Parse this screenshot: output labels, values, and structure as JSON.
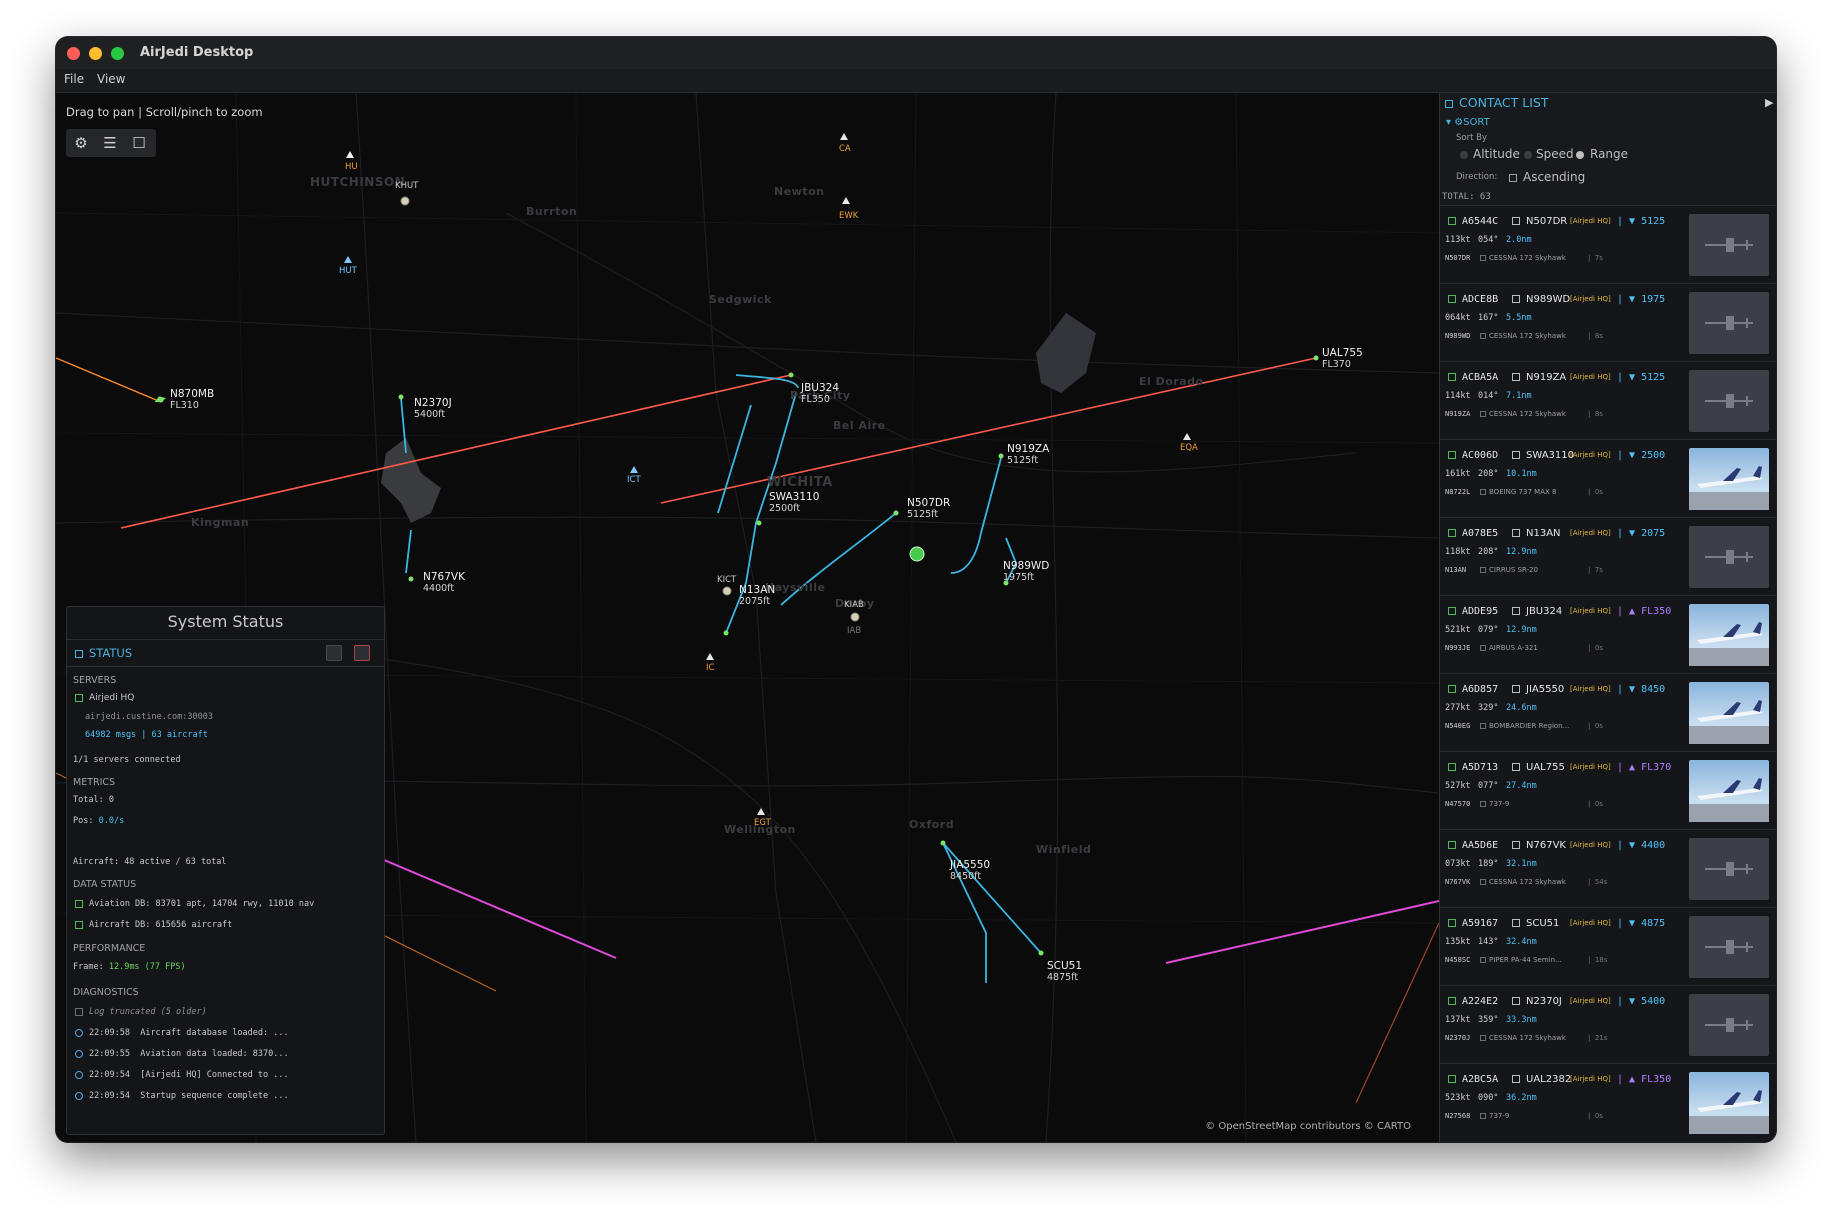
{
  "window": {
    "title": "AirJedi Desktop"
  },
  "menu": [
    "File",
    "View"
  ],
  "map": {
    "hint": "Drag to pan | Scroll/pinch to zoom",
    "attribution": "© OpenStreetMap contributors © CARTO",
    "cities": [
      "HUTCHINSON",
      "Burrton",
      "Newton",
      "Sedgwick",
      "Park City",
      "Bel Aire",
      "WICHITA",
      "El Dorado",
      "Kingman",
      "Haysville",
      "Derby",
      "Wellington",
      "Oxford",
      "Winfield"
    ],
    "airports": [
      "HU",
      "CA",
      "KHUT",
      "EWK",
      "HUT",
      "ICT",
      "KICT",
      "KIAB",
      "IAB",
      "IC",
      "EQA",
      "EGT"
    ],
    "aircraft": [
      {
        "callsign": "N870MB",
        "alt": "FL310"
      },
      {
        "callsign": "N2370J",
        "alt": "5400ft"
      },
      {
        "callsign": "JBU324",
        "alt": "FL350"
      },
      {
        "callsign": "UAL755",
        "alt": "FL370"
      },
      {
        "callsign": "N919ZA",
        "alt": "5125ft"
      },
      {
        "callsign": "SWA3110",
        "alt": "2500ft"
      },
      {
        "callsign": "N507DR",
        "alt": "5125ft"
      },
      {
        "callsign": "N989WD",
        "alt": "1975ft"
      },
      {
        "callsign": "N767VK",
        "alt": "4400ft"
      },
      {
        "callsign": "N13AN",
        "alt": "2075ft"
      },
      {
        "callsign": "JIA5550",
        "alt": "8450ft"
      },
      {
        "callsign": "SCU51",
        "alt": "4875ft"
      }
    ]
  },
  "status": {
    "title": "System Status",
    "header": "STATUS",
    "servers_label": "SERVERS",
    "server_name": "Airjedi HQ",
    "server_host": "airjedi.custine.com:30003",
    "server_stats": "64982 msgs | 63 aircraft",
    "connected": "1/1 servers connected",
    "metrics_label": "METRICS",
    "total_label": "Total:",
    "total_value": "0",
    "pos_label": "Pos:",
    "pos_value": "0.0/s",
    "aircraft_label": "Aircraft:",
    "aircraft_value": "48 active / 63 total",
    "data_status_label": "DATA STATUS",
    "aviation_db_label": "Aviation DB:",
    "aviation_db_value": "83701 apt, 14704 rwy, 11010 nav",
    "aircraft_db_label": "Aircraft DB:",
    "aircraft_db_value": "615656 aircraft",
    "performance_label": "PERFORMANCE",
    "frame_label": "Frame:",
    "frame_value": "12.9ms (77 FPS)",
    "diagnostics_label": "DIAGNOSTICS",
    "log_truncated": "Log truncated (5 older)",
    "logs": [
      {
        "time": "22:09:58",
        "text": "Aircraft database loaded: ..."
      },
      {
        "time": "22:09:55",
        "text": "Aviation data loaded: 8370..."
      },
      {
        "time": "22:09:54",
        "text": "[Airjedi HQ] Connected to ..."
      },
      {
        "time": "22:09:54",
        "text": "Startup sequence complete ..."
      }
    ]
  },
  "contacts": {
    "title": "CONTACT LIST",
    "sort_label": "SORT",
    "sort_by": "Sort By",
    "options": [
      "Altitude",
      "Speed",
      "Range"
    ],
    "selected_option": "Range",
    "direction_label": "Direction:",
    "direction_value": "Ascending",
    "total": "TOTAL: 63",
    "list": [
      {
        "hex": "A6544C",
        "callsign": "N507DR",
        "source": "[Airjedi HQ]",
        "trend": "▼",
        "alt": "5125",
        "speed": "113kt",
        "heading": "054°",
        "range": "2.0nm",
        "reg": "N507DR",
        "type": "CESSNA 172 Skyhawk",
        "age": "7s",
        "photo": false
      },
      {
        "hex": "ADCE8B",
        "callsign": "N989WD",
        "source": "[Airjedi HQ]",
        "trend": "▼",
        "alt": "1975",
        "speed": "064kt",
        "heading": "167°",
        "range": "5.5nm",
        "reg": "N989WD",
        "type": "CESSNA 172 Skyhawk",
        "age": "8s",
        "photo": false
      },
      {
        "hex": "ACBA5A",
        "callsign": "N919ZA",
        "source": "[Airjedi HQ]",
        "trend": "▼",
        "alt": "5125",
        "speed": "114kt",
        "heading": "014°",
        "range": "7.1nm",
        "reg": "N919ZA",
        "type": "CESSNA 172 Skyhawk",
        "age": "8s",
        "photo": false
      },
      {
        "hex": "AC006D",
        "callsign": "SWA3110",
        "source": "[Airjedi HQ]",
        "trend": "▼",
        "alt": "2500",
        "speed": "161kt",
        "heading": "208°",
        "range": "10.1nm",
        "reg": "N8722L",
        "type": "BOEING 737 MAX 8",
        "age": "0s",
        "photo": true
      },
      {
        "hex": "A078E5",
        "callsign": "N13AN",
        "source": "[Airjedi HQ]",
        "trend": "▼",
        "alt": "2075",
        "speed": "118kt",
        "heading": "208°",
        "range": "12.9nm",
        "reg": "N13AN",
        "type": "CIRRUS SR-20",
        "age": "7s",
        "photo": false
      },
      {
        "hex": "ADDE95",
        "callsign": "JBU324",
        "source": "[Airjedi HQ]",
        "trend": "▲",
        "alt": "FL350",
        "speed": "521kt",
        "heading": "079°",
        "range": "12.9nm",
        "reg": "N993JE",
        "type": "AIRBUS A-321",
        "age": "0s",
        "photo": true
      },
      {
        "hex": "A6D857",
        "callsign": "JIA5550",
        "source": "[Airjedi HQ]",
        "trend": "▼",
        "alt": "8450",
        "speed": "277kt",
        "heading": "329°",
        "range": "24.6nm",
        "reg": "N540EG",
        "type": "BOMBARDIER Region...",
        "age": "0s",
        "photo": true
      },
      {
        "hex": "A5D713",
        "callsign": "UAL755",
        "source": "[Airjedi HQ]",
        "trend": "▲",
        "alt": "FL370",
        "speed": "527kt",
        "heading": "077°",
        "range": "27.4nm",
        "reg": "N47570",
        "type": "737-9",
        "age": "0s",
        "photo": true
      },
      {
        "hex": "AA5D6E",
        "callsign": "N767VK",
        "source": "[Airjedi HQ]",
        "trend": "▼",
        "alt": "4400",
        "speed": "073kt",
        "heading": "189°",
        "range": "32.1nm",
        "reg": "N767VK",
        "type": "CESSNA 172 Skyhawk",
        "age": "54s",
        "photo": false
      },
      {
        "hex": "A59167",
        "callsign": "SCU51",
        "source": "[Airjedi HQ]",
        "trend": "▼",
        "alt": "4875",
        "speed": "135kt",
        "heading": "143°",
        "range": "32.4nm",
        "reg": "N458SC",
        "type": "PIPER PA-44 Semin...",
        "age": "18s",
        "photo": false
      },
      {
        "hex": "A224E2",
        "callsign": "N2370J",
        "source": "[Airjedi HQ]",
        "trend": "▼",
        "alt": "5400",
        "speed": "137kt",
        "heading": "359°",
        "range": "33.3nm",
        "reg": "N2370J",
        "type": "CESSNA 172 Skyhawk",
        "age": "21s",
        "photo": false
      },
      {
        "hex": "A2BC5A",
        "callsign": "UAL2382",
        "source": "[Airjedi HQ]",
        "trend": "▲",
        "alt": "FL350",
        "speed": "523kt",
        "heading": "090°",
        "range": "36.2nm",
        "reg": "N27568",
        "type": "737-9",
        "age": "0s",
        "photo": true
      }
    ]
  },
  "colors": {
    "accent": "#4fc3f7",
    "ok": "#6ad45e",
    "track_high": "#ff5a4a",
    "track_low": "#3ab6e0",
    "aircraft": "#7be36a"
  }
}
